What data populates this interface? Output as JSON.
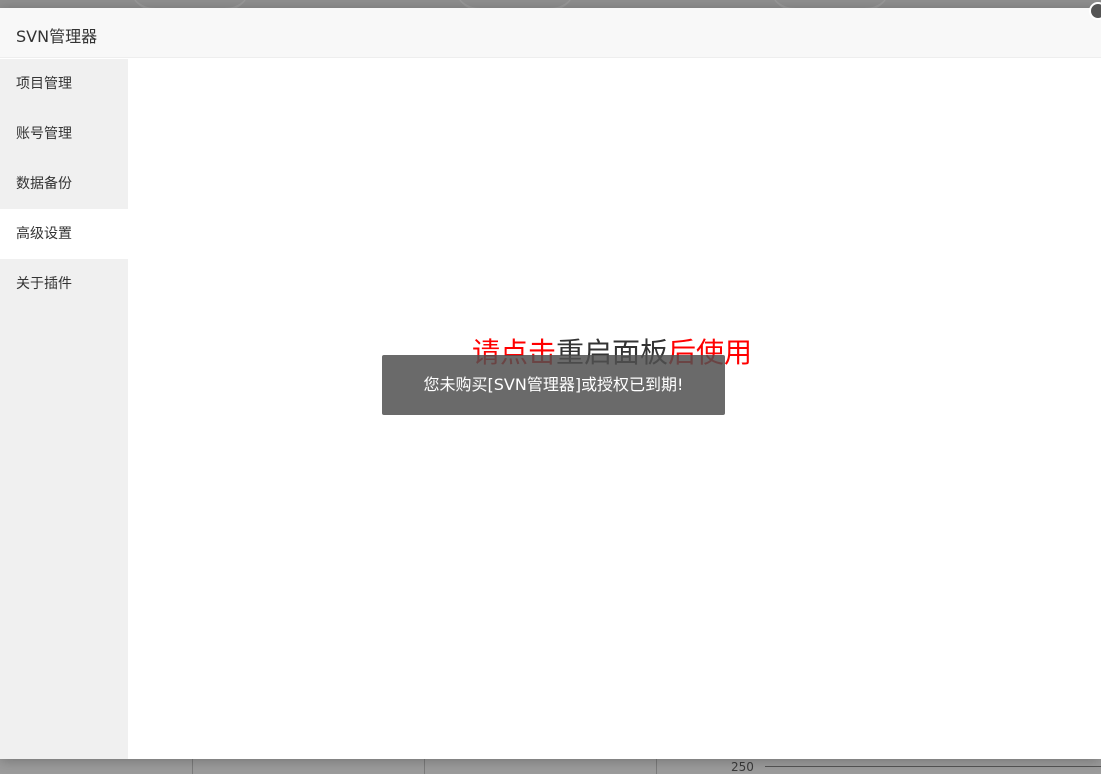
{
  "modal": {
    "title": "SVN管理器"
  },
  "sidebar": {
    "items": [
      {
        "label": "项目管理",
        "active": false
      },
      {
        "label": "账号管理",
        "active": false
      },
      {
        "label": "数据备份",
        "active": false
      },
      {
        "label": "高级设置",
        "active": true
      },
      {
        "label": "关于插件",
        "active": false
      }
    ]
  },
  "notice": {
    "part1": "请点击",
    "part2": "重启面板",
    "part3": "后使用"
  },
  "toast": {
    "message": "您未购买[SVN管理器]或授权已到期!"
  },
  "background": {
    "tick_label": "250"
  },
  "colors": {
    "accent_red": "#ff0000",
    "sidebar_bg": "#f0f0f0",
    "toast_bg": "#505050"
  }
}
